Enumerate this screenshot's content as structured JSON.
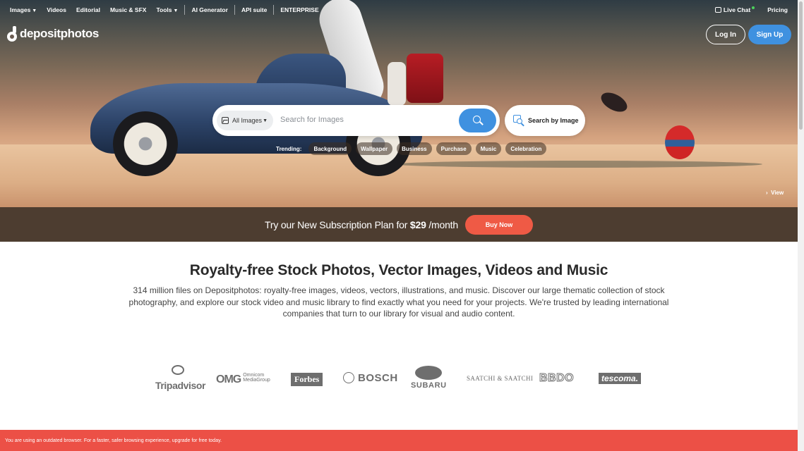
{
  "nav": {
    "items": [
      {
        "label": "Images",
        "caret": true
      },
      {
        "label": "Videos",
        "caret": false
      },
      {
        "label": "Editorial",
        "caret": false
      },
      {
        "label": "Music & SFX",
        "caret": false
      },
      {
        "label": "Tools",
        "caret": true
      },
      {
        "label": "AI Generator",
        "caret": false
      },
      {
        "label": "API suite",
        "caret": false
      },
      {
        "label": "ENTERPRISE",
        "caret": false
      }
    ],
    "live_chat": "Live Chat",
    "pricing": "Pricing"
  },
  "brand": {
    "logo_text": "depositphotos"
  },
  "auth": {
    "login": "Log In",
    "signup": "Sign Up"
  },
  "search": {
    "type_label": "All Images",
    "placeholder": "Search for Images",
    "search_by_image": "Search by Image"
  },
  "trending": {
    "label": "Trending:",
    "chips": [
      "Background",
      "Wallpaper",
      "Business",
      "Purchase",
      "Music",
      "Celebration"
    ]
  },
  "hero": {
    "view_label": "View"
  },
  "promo": {
    "text_before": "Try our New Subscription Plan for ",
    "price": "$29",
    "text_after": " /month",
    "button": "Buy Now"
  },
  "main": {
    "title": "Royalty-free Stock Photos, Vector Images, Videos and Music",
    "description": "314 million files on Depositphotos: royalty-free images, videos, vectors, illustrations, and music. Discover our large thematic collection of stock photography, and explore our stock video and music library to find exactly what you need for your projects. We're trusted by leading international companies that turn to our library for visual and audio content."
  },
  "clients": {
    "tripadvisor": "Tripadvisor",
    "omg": "OMG",
    "omg_sub_1": "Omnicom",
    "omg_sub_2": "MediaGroup",
    "forbes": "Forbes",
    "bosch": "BOSCH",
    "subaru": "SUBARU",
    "saatchi": "SAATCHI & SAATCHI",
    "bbdo": "BBDO",
    "tesco": "tescoma."
  },
  "alert": {
    "message": "You are using an outdated browser. For a faster, safer browsing experience, upgrade for free today."
  },
  "colors": {
    "accent_blue": "#3f91e0",
    "promo_bg": "#4d3d30",
    "buy_now": "#ef5a45",
    "alert_red": "#ec5046"
  }
}
